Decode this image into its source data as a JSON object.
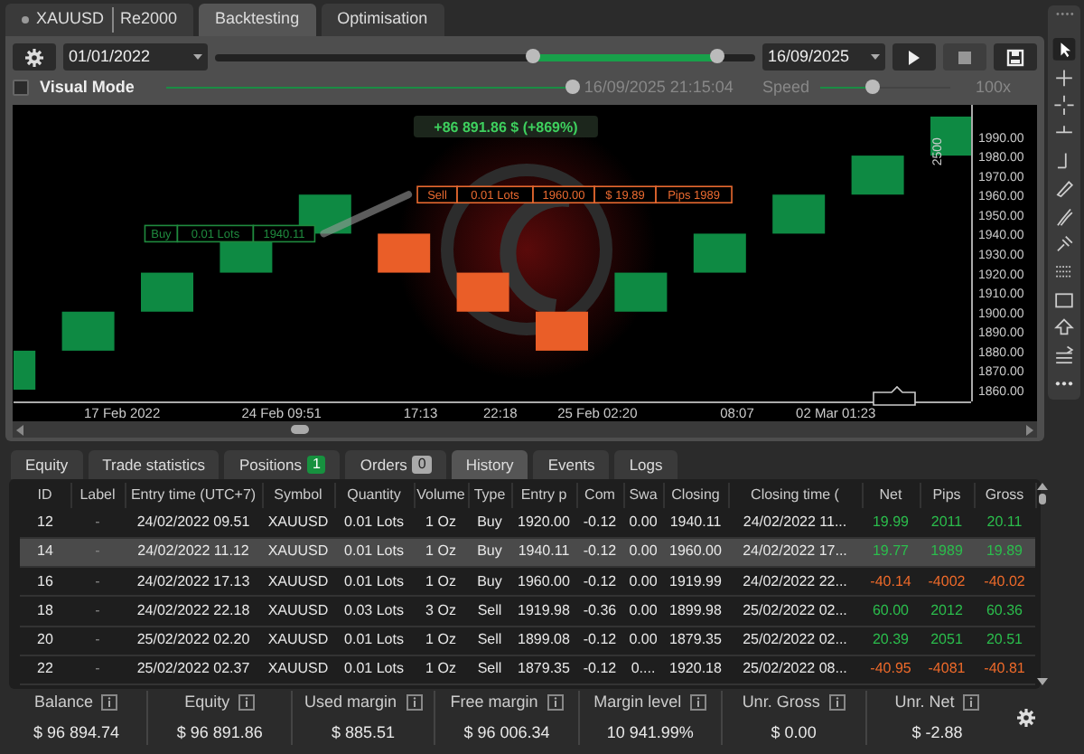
{
  "tabs": [
    {
      "kind": "symbol",
      "label": "XAUUSD",
      "sub": "Re2000",
      "selected": false
    },
    {
      "kind": "plain",
      "label": "Backtesting",
      "selected": true
    },
    {
      "kind": "plain",
      "label": "Optimisation",
      "selected": false
    }
  ],
  "controls": {
    "start_date": "01/01/2022",
    "end_date": "16/09/2025",
    "range": [
      {
        "level": 0.59
      },
      {
        "level": 0.93
      }
    ],
    "buttons": [
      {
        "kind": "play",
        "disabled": false
      },
      {
        "kind": "stop",
        "disabled": true
      },
      {
        "kind": "save",
        "disabled": false
      }
    ]
  },
  "visual": {
    "label": "Visual Mode",
    "checked": false,
    "progress": {
      "level": 1
    },
    "time": "16/09/2025 21:15:04",
    "speed_label": "Speed",
    "speed": {
      "level": 0.4
    },
    "speed_value": "100x"
  },
  "chart": {
    "price_labels": [
      "1990.00",
      "1980.00",
      "1970.00",
      "1960.00",
      "1950.00",
      "1940.00",
      "1930.00",
      "1920.00",
      "1910.00",
      "1900.00",
      "1890.00",
      "1880.00",
      "1870.00",
      "1860.00"
    ],
    "time_labels": [
      "17 Feb 2022",
      "24 Feb 09:51",
      "17:13",
      "22:18",
      "25 Feb 02:20",
      "08:07",
      "02 Mar 01:23"
    ],
    "profit": "+86 891.86 $ (+869%)",
    "trades": [
      {
        "color": "#1f8a3e",
        "parts": [
          "Buy",
          "0.01 Lots",
          "1940.11"
        ]
      },
      {
        "color": "#ea6a30",
        "parts": [
          "Sell",
          "0.01 Lots",
          "1960.00",
          "$ 19.89",
          "Pips 1989"
        ]
      }
    ],
    "brick_size": "2500"
  },
  "bottom_tabs": [
    {
      "label": "Equity",
      "selected": false
    },
    {
      "label": "Trade statistics",
      "selected": false
    },
    {
      "label": "Positions",
      "badge": "1",
      "badge_active": true,
      "selected": false
    },
    {
      "label": "Orders",
      "badge": "0",
      "badge_active": false,
      "selected": false
    },
    {
      "label": "History",
      "selected": true
    },
    {
      "label": "Events",
      "selected": false
    },
    {
      "label": "Logs",
      "selected": false
    }
  ],
  "table": {
    "columns": [
      "ID",
      "Label",
      "Entry time (UTC+7)",
      "Symbol",
      "Quantity",
      "Volume",
      "Type",
      "Entry p",
      "Com",
      "Swa",
      "Closing",
      "Closing time (",
      "Net",
      "Pips",
      "Gross"
    ],
    "rows": [
      {
        "selected": false,
        "loss": false,
        "cells": [
          "12",
          "-",
          "24/02/2022 09.51",
          "XAUUSD",
          "0.01 Lots",
          "1 Oz",
          "Buy",
          "1920.00",
          "-0.12",
          "0.00",
          "1940.11",
          "24/02/2022 11...",
          "19.99",
          "2011",
          "20.11"
        ]
      },
      {
        "selected": true,
        "loss": false,
        "cells": [
          "14",
          "-",
          "24/02/2022 11.12",
          "XAUUSD",
          "0.01 Lots",
          "1 Oz",
          "Buy",
          "1940.11",
          "-0.12",
          "0.00",
          "1960.00",
          "24/02/2022 17...",
          "19.77",
          "1989",
          "19.89"
        ]
      },
      {
        "selected": false,
        "loss": true,
        "cells": [
          "16",
          "-",
          "24/02/2022 17.13",
          "XAUUSD",
          "0.01 Lots",
          "1 Oz",
          "Buy",
          "1960.00",
          "-0.12",
          "0.00",
          "1919.99",
          "24/02/2022 22...",
          "-40.14",
          "-4002",
          "-40.02"
        ]
      },
      {
        "selected": false,
        "loss": false,
        "cells": [
          "18",
          "-",
          "24/02/2022 22.18",
          "XAUUSD",
          "0.03 Lots",
          "3 Oz",
          "Sell",
          "1919.98",
          "-0.36",
          "0.00",
          "1899.98",
          "25/02/2022 02...",
          "60.00",
          "2012",
          "60.36"
        ]
      },
      {
        "selected": false,
        "loss": false,
        "cells": [
          "20",
          "-",
          "25/02/2022 02.20",
          "XAUUSD",
          "0.01 Lots",
          "1 Oz",
          "Sell",
          "1899.08",
          "-0.12",
          "0.00",
          "1879.35",
          "25/02/2022 02...",
          "20.39",
          "2051",
          "20.51"
        ]
      },
      {
        "selected": false,
        "loss": true,
        "cells": [
          "22",
          "-",
          "25/02/2022 02.37",
          "XAUUSD",
          "0.01 Lots",
          "1 Oz",
          "Sell",
          "1879.35",
          "-0.12",
          "0....",
          "1920.18",
          "25/02/2022 08...",
          "-40.95",
          "-4081",
          "-40.81"
        ]
      }
    ]
  },
  "stats": [
    {
      "label": "Balance",
      "value": "$ 96 894.74"
    },
    {
      "label": "Equity",
      "value": "$ 96 891.86"
    },
    {
      "label": "Used margin",
      "value": "$ 885.51"
    },
    {
      "label": "Free margin",
      "value": "$ 96 006.34"
    },
    {
      "label": "Margin level",
      "value": "10 941.99%"
    },
    {
      "label": "Unr. Gross",
      "value": "$ 0.00"
    },
    {
      "label": "Unr. Net",
      "value": "$ -2.88"
    }
  ]
}
